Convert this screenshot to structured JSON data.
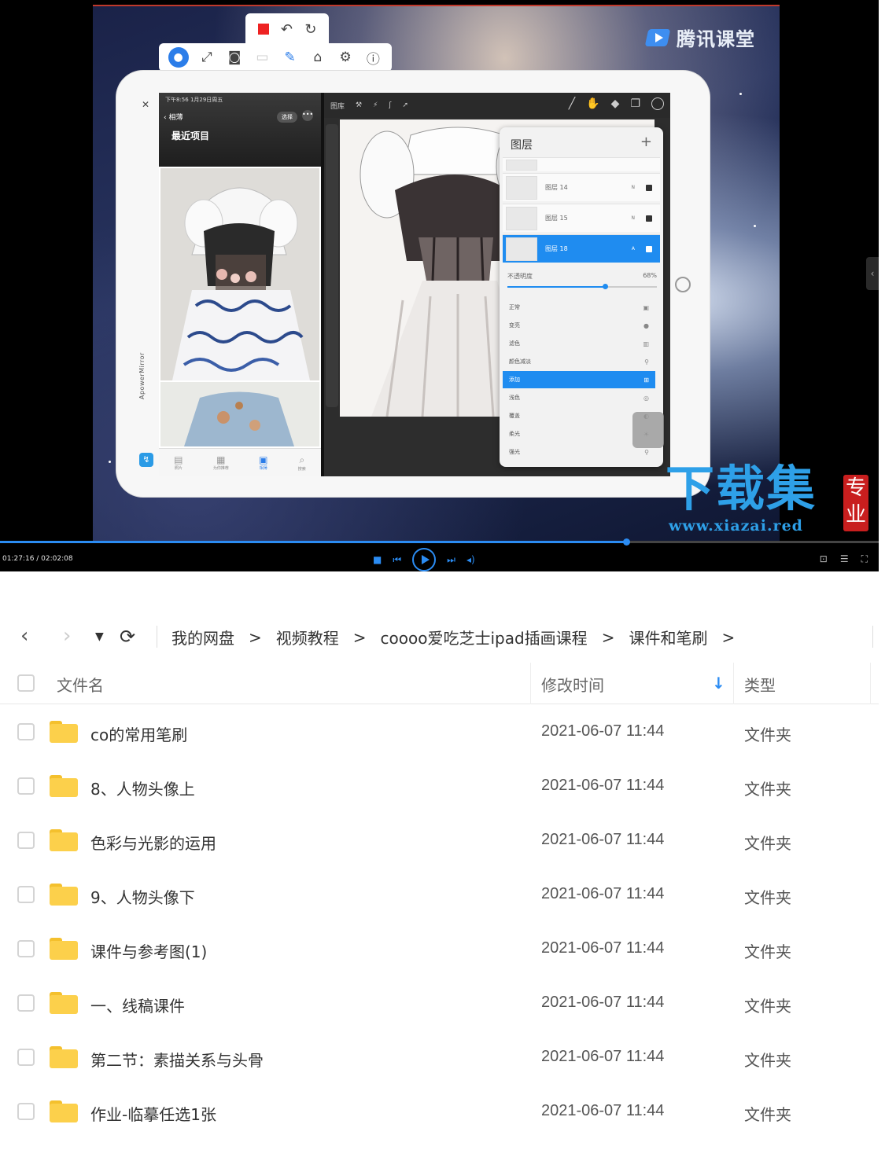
{
  "player": {
    "brand_text": "腾讯课堂",
    "time": "01:27:16 / 02:02:08",
    "progress": 0.713
  },
  "ipad": {
    "side_label": "ApowerMirror",
    "photos": {
      "status": "下午8:56  1月29日周五",
      "back": "相薄",
      "title": "最近项目",
      "select": "选择",
      "tabs": [
        "照片",
        "为你推荐",
        "相薄",
        "搜索"
      ]
    },
    "procreate": {
      "gallery": "图库",
      "layers_title": "图层",
      "layers": [
        {
          "name": "图层 14",
          "mode": "N"
        },
        {
          "name": "图层 15",
          "mode": "N"
        },
        {
          "name": "图层 18",
          "mode": "A"
        }
      ],
      "opacity_label": "不透明度",
      "opacity_value": "68%",
      "blend_modes": [
        "正常",
        "变亮",
        "滤色",
        "颜色减淡",
        "添加",
        "浅色",
        "覆盖",
        "柔光",
        "强光"
      ],
      "selected_blend": "添加"
    }
  },
  "watermark": {
    "text": "下载集",
    "seal": "专业",
    "url": "www.xiazai.red"
  },
  "browser": {
    "breadcrumb": [
      "我的网盘",
      "视频教程",
      "coooo爱吃芝士ipad插画课程",
      "课件和笔刷"
    ],
    "columns": {
      "name": "文件名",
      "modified": "修改时间",
      "type": "类型"
    },
    "files": [
      {
        "name": "co的常用笔刷",
        "modified": "2021-06-07 11:44",
        "type": "文件夹"
      },
      {
        "name": "8、人物头像上",
        "modified": "2021-06-07 11:44",
        "type": "文件夹"
      },
      {
        "name": "色彩与光影的运用",
        "modified": "2021-06-07 11:44",
        "type": "文件夹"
      },
      {
        "name": "9、人物头像下",
        "modified": "2021-06-07 11:44",
        "type": "文件夹"
      },
      {
        "name": "课件与参考图(1)",
        "modified": "2021-06-07 11:44",
        "type": "文件夹"
      },
      {
        "name": "一、线稿课件",
        "modified": "2021-06-07 11:44",
        "type": "文件夹"
      },
      {
        "name": "第二节：素描关系与头骨",
        "modified": "2021-06-07 11:44",
        "type": "文件夹"
      },
      {
        "name": "作业-临摹任选1张",
        "modified": "2021-06-07 11:44",
        "type": "文件夹"
      }
    ]
  }
}
